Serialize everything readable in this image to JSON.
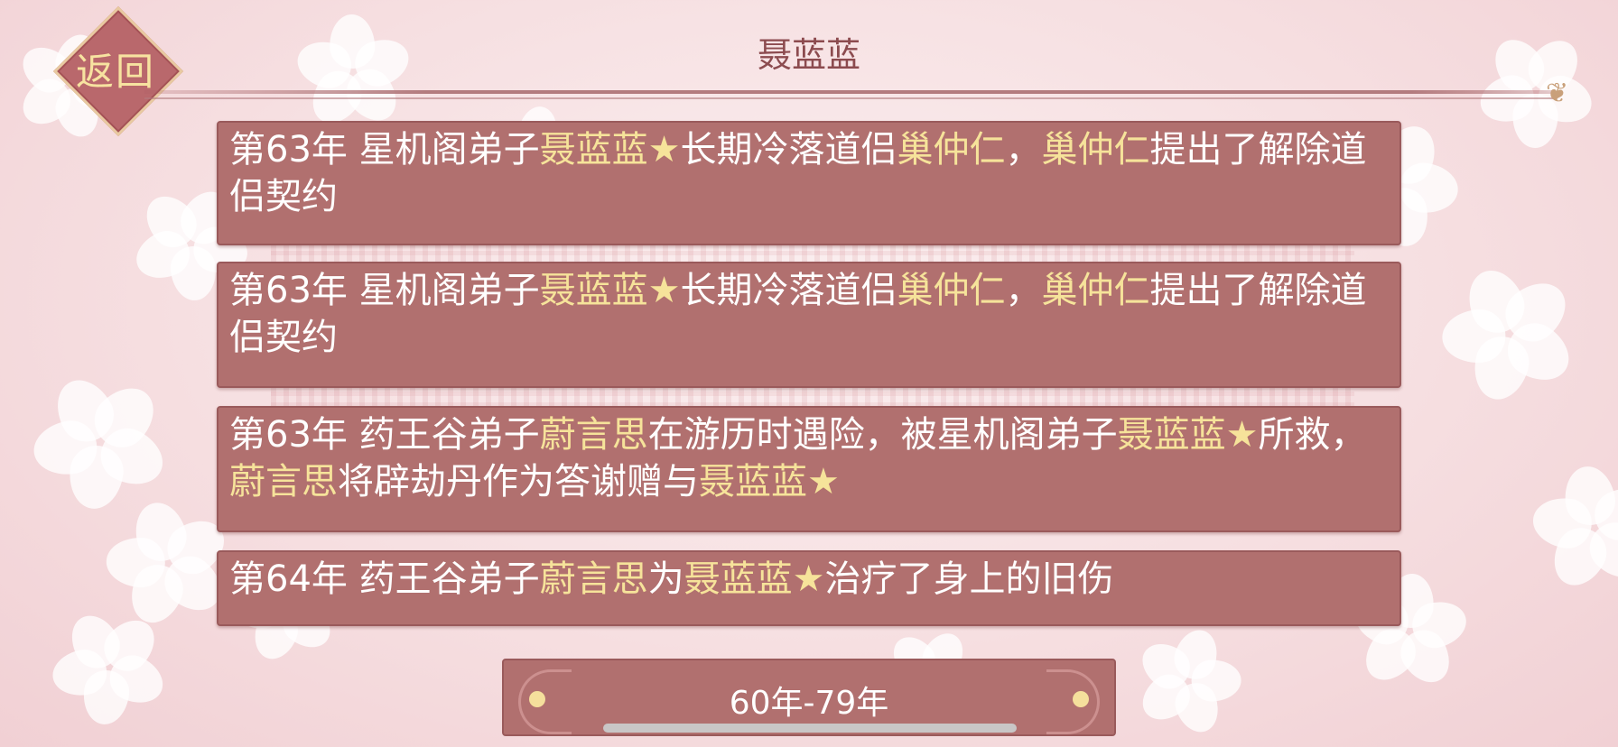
{
  "header": {
    "back_label": "返回",
    "title": "聂蓝蓝"
  },
  "events": [
    {
      "segments": [
        {
          "text": "第63年 星机阁弟子",
          "hl": false
        },
        {
          "text": "聂蓝蓝★",
          "hl": true
        },
        {
          "text": "长期冷落道侣",
          "hl": false
        },
        {
          "text": "巢仲仁",
          "hl": true
        },
        {
          "text": "，",
          "hl": false
        },
        {
          "text": "巢仲仁",
          "hl": true
        },
        {
          "text": "提出了解除道侣契约",
          "hl": false
        }
      ]
    },
    {
      "segments": [
        {
          "text": "第63年 星机阁弟子",
          "hl": false
        },
        {
          "text": "聂蓝蓝★",
          "hl": true
        },
        {
          "text": "长期冷落道侣",
          "hl": false
        },
        {
          "text": "巢仲仁",
          "hl": true
        },
        {
          "text": "，",
          "hl": false
        },
        {
          "text": "巢仲仁",
          "hl": true
        },
        {
          "text": "提出了解除道侣契约",
          "hl": false
        }
      ]
    },
    {
      "segments": [
        {
          "text": "第63年 药王谷弟子",
          "hl": false
        },
        {
          "text": "蔚言思",
          "hl": true
        },
        {
          "text": "在游历时遇险，被星机阁弟子",
          "hl": false
        },
        {
          "text": "聂蓝蓝★",
          "hl": true
        },
        {
          "text": "所救，",
          "hl": false
        },
        {
          "text": "蔚言思",
          "hl": true
        },
        {
          "text": "将辟劫丹作为答谢赠与",
          "hl": false
        },
        {
          "text": "聂蓝蓝★",
          "hl": true
        }
      ]
    },
    {
      "segments": [
        {
          "text": "第64年 药王谷弟子",
          "hl": false
        },
        {
          "text": "蔚言思",
          "hl": true
        },
        {
          "text": "为",
          "hl": false
        },
        {
          "text": "聂蓝蓝★",
          "hl": true
        },
        {
          "text": "治疗了身上的旧伤",
          "hl": false
        }
      ]
    }
  ],
  "pager": {
    "range_label": "60年-79年"
  },
  "colors": {
    "highlight": "#f6e39a",
    "card": "#b1706f",
    "title": "#8c4b4f"
  }
}
